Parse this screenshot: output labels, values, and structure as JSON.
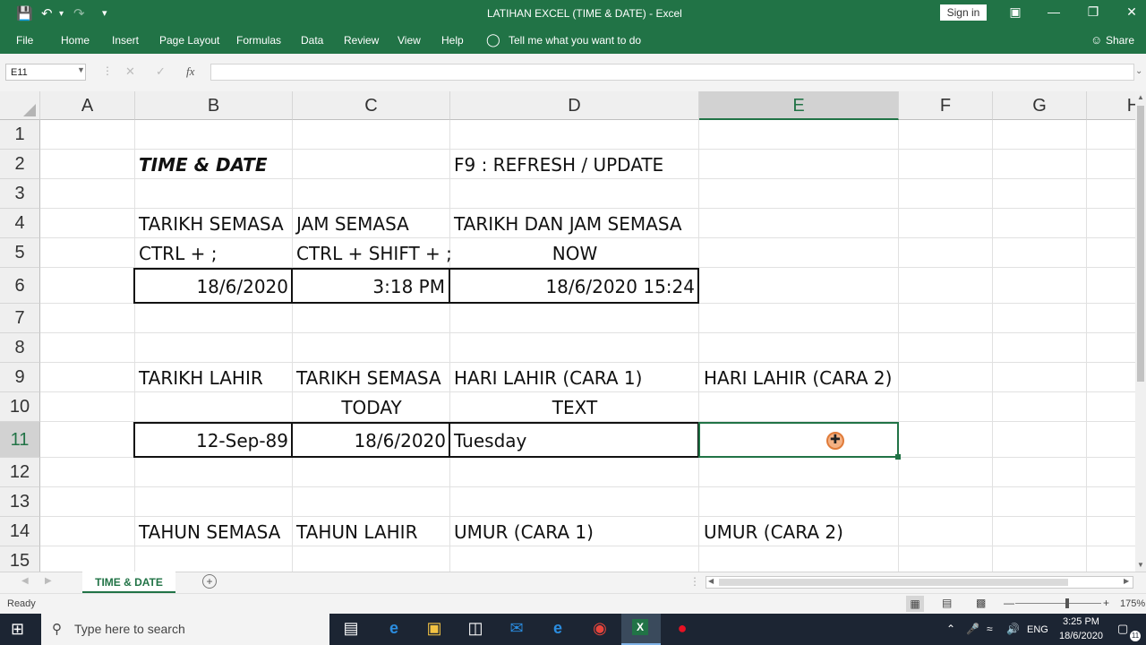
{
  "titlebar": {
    "title": "LATIHAN EXCEL (TIME & DATE)  -  Excel",
    "sign_in": "Sign in"
  },
  "ribbon": {
    "tabs": [
      "File",
      "Home",
      "Insert",
      "Page Layout",
      "Formulas",
      "Data",
      "Review",
      "View",
      "Help"
    ],
    "tell_me": "Tell me what you want to do",
    "share": "Share"
  },
  "formula_bar": {
    "name_box": "E11",
    "fx": "fx",
    "content": ""
  },
  "grid": {
    "columns": [
      "A",
      "B",
      "C",
      "D",
      "E",
      "F",
      "G",
      "H"
    ],
    "selected_column": "E",
    "rows": [
      "1",
      "2",
      "3",
      "4",
      "5",
      "6",
      "7",
      "8",
      "9",
      "10",
      "11",
      "12",
      "13",
      "14",
      "15"
    ],
    "cells": {
      "B2": "TIME & DATE",
      "D2": "F9 : REFRESH / UPDATE",
      "B4": "TARIKH SEMASA",
      "C4": "JAM SEMASA",
      "D4": "TARIKH DAN JAM SEMASA",
      "B5": "CTRL + ;",
      "C5": "CTRL + SHIFT + ;",
      "D5": "NOW",
      "B6": "18/6/2020",
      "C6": "3:18 PM",
      "D6": "18/6/2020 15:24",
      "B9": "TARIKH LAHIR",
      "C9": "TARIKH SEMASA",
      "D9": "HARI LAHIR (CARA 1)",
      "E9": "HARI LAHIR (CARA 2)",
      "C10": "TODAY",
      "D10": "TEXT",
      "B11": "12-Sep-89",
      "C11": "18/6/2020",
      "D11": "Tuesday",
      "B14": "TAHUN SEMASA",
      "C14": "TAHUN LAHIR",
      "D14": "UMUR (CARA 1)",
      "E14": "UMUR (CARA 2)"
    }
  },
  "sheets": {
    "active": "TIME & DATE"
  },
  "status": {
    "ready": "Ready",
    "zoom": "175%"
  },
  "taskbar": {
    "search_placeholder": "Type here to search",
    "language": "ENG",
    "time": "3:25 PM",
    "date": "18/6/2020",
    "notifications": "11"
  },
  "colors": {
    "excel_green": "#217346",
    "taskbar": "#1c2533"
  }
}
